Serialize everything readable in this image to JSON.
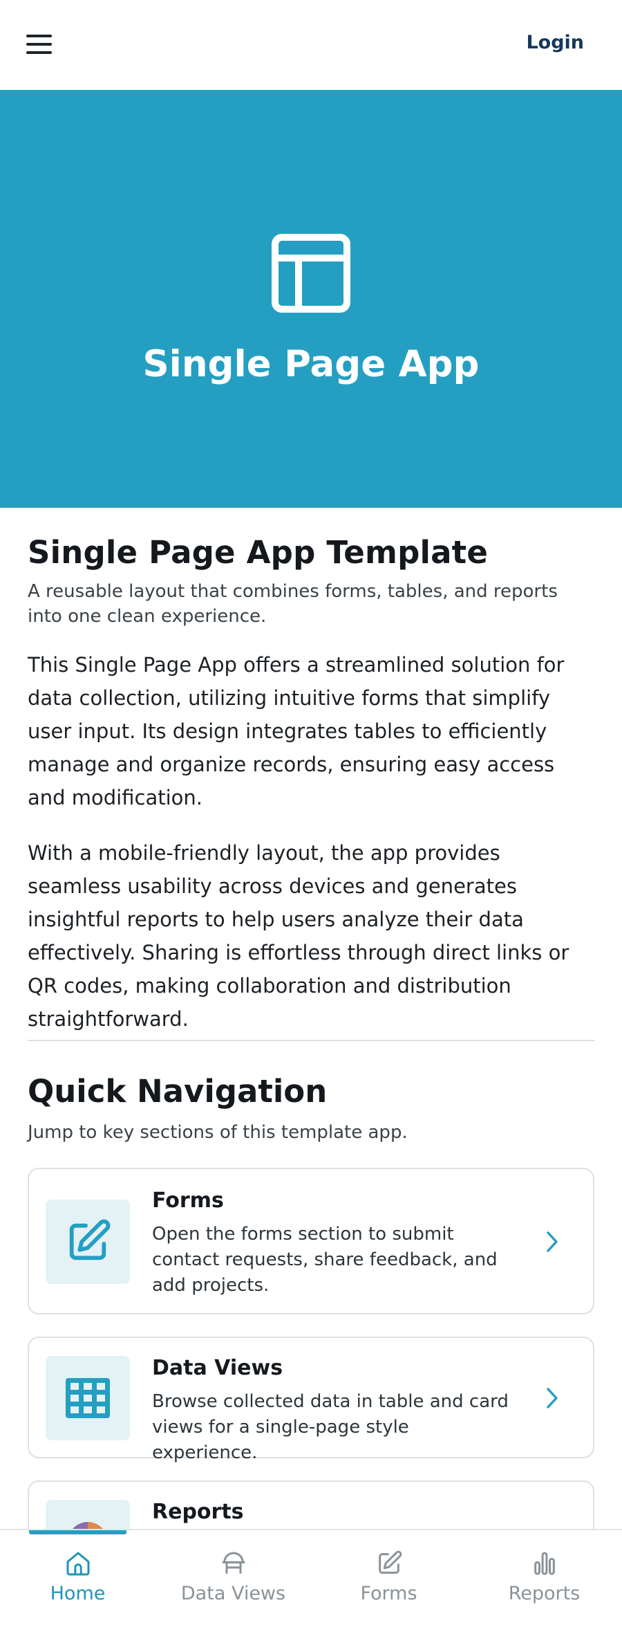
{
  "header": {
    "login_label": "Login"
  },
  "hero": {
    "title": "Single Page App"
  },
  "intro": {
    "title": "Single Page App Template",
    "subtitle": "A reusable layout that combines forms, tables, and reports into one clean experience.",
    "paragraphs": [
      "This Single Page App offers a streamlined solution for data collection, utilizing intuitive forms that simplify user input. Its design integrates tables to efficiently manage and organize records, ensuring easy access and modification.",
      "With a mobile-friendly layout, the app provides seamless usability across devices and generates insightful reports to help users analyze their data effectively. Sharing is effortless through direct links or QR codes, making collaboration and distribution straightforward."
    ]
  },
  "quick_nav": {
    "title": "Quick Navigation",
    "subtitle": "Jump to key sections of this template app.",
    "cards": [
      {
        "title": "Forms",
        "description": "Open the forms section to submit contact requests, share feedback, and add projects.",
        "icon": "edit-icon"
      },
      {
        "title": "Data Views",
        "description": "Browse collected data in table and card views for a single-page style experience.",
        "icon": "grid-table-icon"
      },
      {
        "title": "Reports",
        "description": "",
        "icon": "pie-chart-icon"
      }
    ]
  },
  "tabbar": {
    "active": "Home",
    "tabs": [
      {
        "label": "Home",
        "icon": "home-icon"
      },
      {
        "label": "Data Views",
        "icon": "data-views-icon"
      },
      {
        "label": "Forms",
        "icon": "forms-icon"
      },
      {
        "label": "Reports",
        "icon": "reports-icon"
      }
    ]
  },
  "colors": {
    "accent": "#259fc1",
    "tile_bg": "#e4f2f6",
    "heading": "#15191d",
    "login": "#163859",
    "tab_inactive": "#8a9298"
  }
}
